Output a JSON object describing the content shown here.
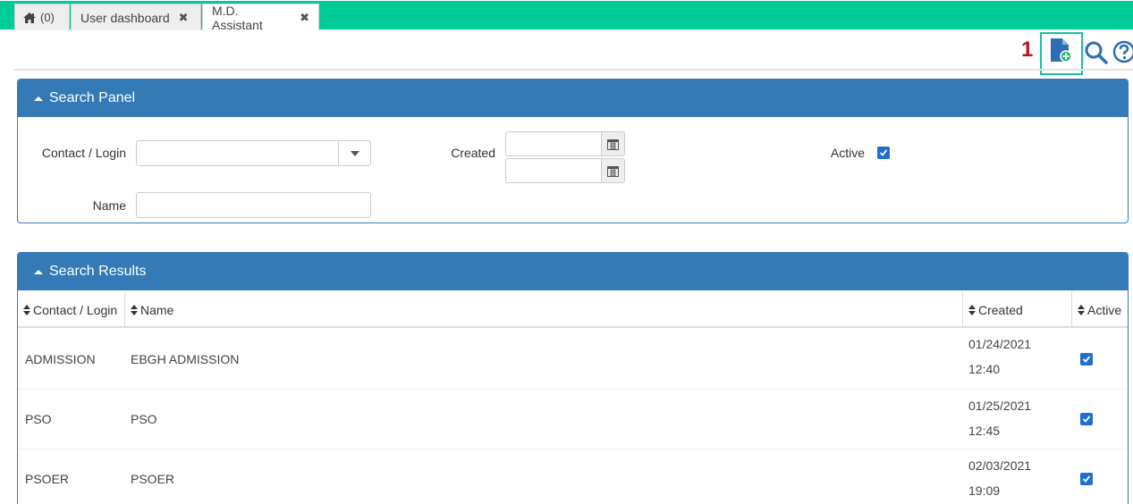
{
  "tabs": {
    "home_count": "(0)",
    "user_dashboard": "User dashboard",
    "md_assistant": "M.D. Assistant",
    "close_glyph": "✖"
  },
  "toolbar": {
    "step_number": "1"
  },
  "search_panel": {
    "title": "Search Panel",
    "contact_login_label": "Contact / Login",
    "name_label": "Name",
    "created_label": "Created",
    "active_label": "Active",
    "active_checked": true
  },
  "results": {
    "title": "Search Results",
    "columns": [
      "Contact / Login",
      "Name",
      "Created",
      "Active"
    ],
    "rows": [
      {
        "login": "ADMISSION",
        "name": "EBGH ADMISSION",
        "date": "01/24/2021",
        "time": "12:40",
        "active": true
      },
      {
        "login": "PSO",
        "name": "PSO",
        "date": "01/25/2021",
        "time": "12:45",
        "active": true
      },
      {
        "login": "PSOER",
        "name": "PSOER",
        "date": "02/03/2021",
        "time": "19:09",
        "active": true
      }
    ]
  },
  "colors": {
    "tabbar_green": "#00cc9a",
    "panel_blue": "#337ab7",
    "highlight_box": "#18c2a0",
    "step_red": "#c0141b",
    "checkbox_blue": "#1f6fcf"
  },
  "icons": [
    "home-icon",
    "close-icon",
    "new-document-icon",
    "search-icon",
    "help-icon",
    "calendar-icon",
    "caret-up-icon",
    "sort-icon",
    "checkbox-checked-icon",
    "dropdown-arrow-icon"
  ]
}
